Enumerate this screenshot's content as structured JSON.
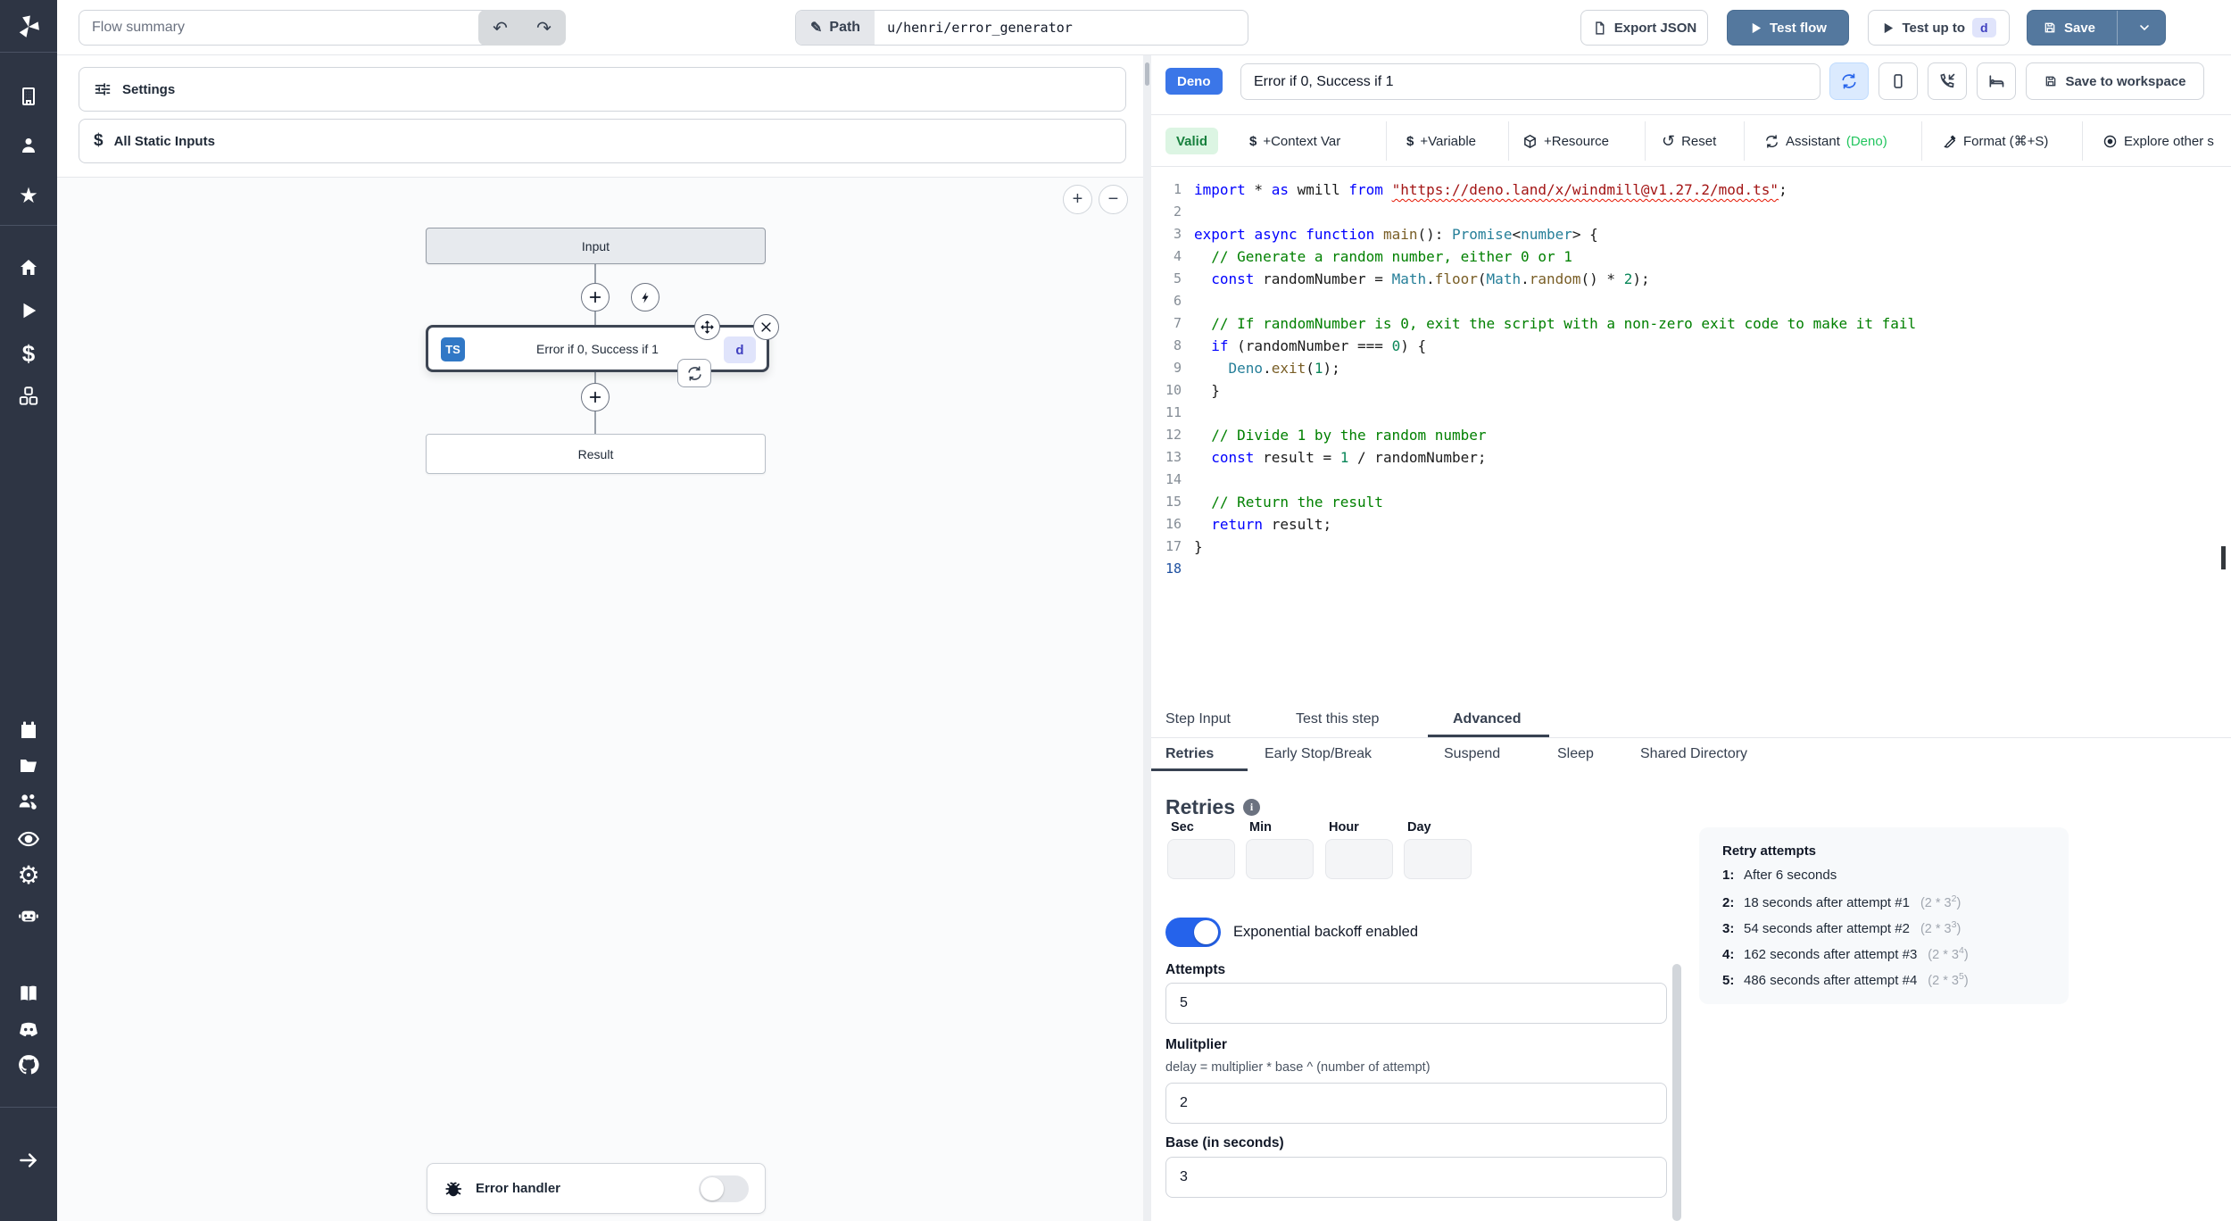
{
  "colors": {
    "accent_blue": "#54789e",
    "badge_blue": "#3b76e8",
    "ts_blue": "#3178c6",
    "valid_green_bg": "#dcf5e3",
    "valid_green_text": "#17803d",
    "assistant_green": "#22c55e",
    "toggle_on": "#2563eb",
    "sidebar_bg": "#2e3544",
    "indigo_chip_bg": "#e0e4fb",
    "indigo_chip_text": "#4040c0"
  },
  "icons": {
    "undo": "↶",
    "redo": "↷",
    "pencil": "✎",
    "reset": "↺",
    "plus": "+",
    "minus": "−",
    "star": "★",
    "gear": "⚙",
    "dollar": "$",
    "close": "×"
  },
  "sidebar_icon_names": [
    "windmill-logo",
    "building",
    "user",
    "star",
    "home",
    "play",
    "dollar",
    "cubes",
    "calendar",
    "folder",
    "user-group",
    "eye",
    "gear",
    "robot",
    "book",
    "discord",
    "github",
    "arrow-right"
  ],
  "topbar": {
    "flow_summary_placeholder": "Flow summary",
    "path_label": "Path",
    "path_value": "u/henri/error_generator",
    "export_json": "Export JSON",
    "test_flow": "Test flow",
    "test_up_to": "Test up to",
    "test_up_to_badge": "d",
    "save": "Save"
  },
  "left_panel": {
    "settings": "Settings",
    "all_static_inputs": "All Static Inputs",
    "error_handler": "Error handler"
  },
  "flow": {
    "input_node": "Input",
    "step_node": "Error if 0, Success if 1",
    "step_lang_badge": "TS",
    "step_id_badge": "d",
    "result_node": "Result"
  },
  "editor_header": {
    "lang_badge": "Deno",
    "title": "Error if 0, Success if 1",
    "save_to_workspace": "Save to workspace"
  },
  "editor_toolbar": {
    "valid": "Valid",
    "context_var": "+Context Var",
    "variable": "+Variable",
    "resource": "+Resource",
    "reset": "Reset",
    "assistant": "Assistant",
    "assistant_lang": "(Deno)",
    "format": "Format (⌘+S)",
    "explore": "Explore other s"
  },
  "code": {
    "lines": [
      [
        [
          "k",
          "import"
        ],
        [
          "p",
          " * "
        ],
        [
          "k",
          "as"
        ],
        [
          "p",
          " wmill "
        ],
        [
          "k",
          "from"
        ],
        [
          "p",
          " "
        ],
        [
          "su",
          "\"https://deno.land/x/windmill@v1.27.2/mod.ts\""
        ],
        [
          "p",
          ";"
        ]
      ],
      [],
      [
        [
          "k",
          "export"
        ],
        [
          "p",
          " "
        ],
        [
          "k",
          "async"
        ],
        [
          "p",
          " "
        ],
        [
          "k",
          "function"
        ],
        [
          "p",
          " "
        ],
        [
          "f",
          "main"
        ],
        [
          "p",
          "(): "
        ],
        [
          "t",
          "Promise"
        ],
        [
          "p",
          "<"
        ],
        [
          "t",
          "number"
        ],
        [
          "p",
          "> {"
        ]
      ],
      [
        [
          "c",
          "  // Generate a random number, either 0 or 1"
        ]
      ],
      [
        [
          "k",
          "  const"
        ],
        [
          "p",
          " randomNumber = "
        ],
        [
          "t",
          "Math"
        ],
        [
          "p",
          "."
        ],
        [
          "f",
          "floor"
        ],
        [
          "p",
          "("
        ],
        [
          "t",
          "Math"
        ],
        [
          "p",
          "."
        ],
        [
          "f",
          "random"
        ],
        [
          "p",
          "() * "
        ],
        [
          "n",
          "2"
        ],
        [
          "p",
          ");"
        ]
      ],
      [],
      [
        [
          "c",
          "  // If randomNumber is 0, exit the script with a non-zero exit code to make it fail"
        ]
      ],
      [
        [
          "k",
          "  if"
        ],
        [
          "p",
          " (randomNumber === "
        ],
        [
          "n",
          "0"
        ],
        [
          "p",
          ") {"
        ]
      ],
      [
        [
          "p",
          "    "
        ],
        [
          "t",
          "Deno"
        ],
        [
          "p",
          "."
        ],
        [
          "f",
          "exit"
        ],
        [
          "p",
          "("
        ],
        [
          "n",
          "1"
        ],
        [
          "p",
          ");"
        ]
      ],
      [
        [
          "p",
          "  }"
        ]
      ],
      [],
      [
        [
          "c",
          "  // Divide 1 by the random number"
        ]
      ],
      [
        [
          "k",
          "  const"
        ],
        [
          "p",
          " result = "
        ],
        [
          "n",
          "1"
        ],
        [
          "p",
          " / randomNumber;"
        ]
      ],
      [],
      [
        [
          "c",
          "  // Return the result"
        ]
      ],
      [
        [
          "k",
          "  return"
        ],
        [
          "p",
          " result;"
        ]
      ],
      [
        [
          "p",
          "}"
        ]
      ],
      []
    ],
    "active_line": 18
  },
  "tabs": {
    "primary": [
      {
        "label": "Step Input",
        "active": false
      },
      {
        "label": "Test this step",
        "active": false
      },
      {
        "label": "Advanced",
        "active": true
      }
    ],
    "secondary": [
      {
        "label": "Retries",
        "active": true
      },
      {
        "label": "Early Stop/Break",
        "active": false
      },
      {
        "label": "Suspend",
        "active": false
      },
      {
        "label": "Sleep",
        "active": false
      },
      {
        "label": "Shared Directory",
        "active": false
      }
    ]
  },
  "retries": {
    "heading": "Retries",
    "time_labels": [
      "Sec",
      "Min",
      "Hour",
      "Day"
    ],
    "backoff_label": "Exponential backoff enabled",
    "backoff_enabled": true,
    "attempts_label": "Attempts",
    "attempts_value": "5",
    "multiplier_label": "Mulitplier",
    "multiplier_help": "delay = multiplier * base ^ (number of attempt)",
    "multiplier_value": "2",
    "base_label": "Base (in seconds)",
    "base_value": "3",
    "box_title": "Retry attempts",
    "attempts_list": [
      {
        "n": "1:",
        "text": "After 6 seconds"
      },
      {
        "n": "2:",
        "text": "18 seconds after attempt #1",
        "f_pre": "(2 * 3",
        "f_sup": "2",
        "f_post": ")"
      },
      {
        "n": "3:",
        "text": "54 seconds after attempt #2",
        "f_pre": "(2 * 3",
        "f_sup": "3",
        "f_post": ")"
      },
      {
        "n": "4:",
        "text": "162 seconds after attempt #3",
        "f_pre": "(2 * 3",
        "f_sup": "4",
        "f_post": ")"
      },
      {
        "n": "5:",
        "text": "486 seconds after attempt #4",
        "f_pre": "(2 * 3",
        "f_sup": "5",
        "f_post": ")"
      }
    ]
  }
}
